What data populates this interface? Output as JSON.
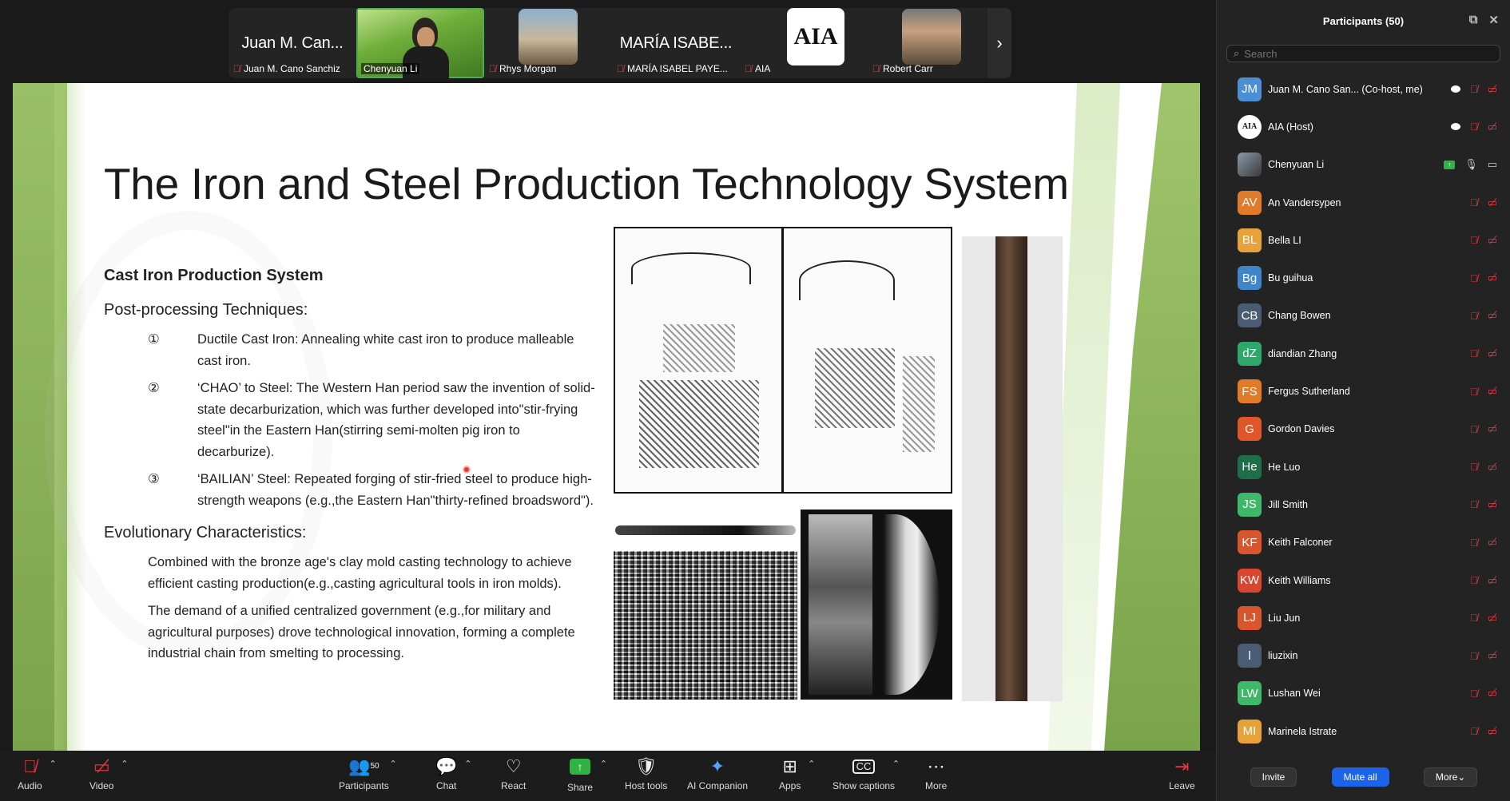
{
  "gallery": {
    "tiles": [
      {
        "big": "Juan M. Can...",
        "label": "Juan M. Cano Sanchiz",
        "muted": true
      },
      {
        "big": "",
        "label": "Chenyuan Li",
        "muted": false
      },
      {
        "big": "",
        "label": "Rhys Morgan",
        "muted": true
      },
      {
        "big": "MARÍA ISABE...",
        "label": "MARÍA ISABEL PAYE...",
        "muted": true
      },
      {
        "big": "",
        "label": "AIA",
        "muted": true,
        "logo": "AIA"
      },
      {
        "big": "",
        "label": "Robert Carr",
        "muted": true
      }
    ],
    "next_icon": "chevron-right-icon"
  },
  "slide": {
    "title": "The Iron and Steel Production Technology System",
    "section": "Cast Iron Production System",
    "subheading": "Post-processing Techniques:",
    "items": [
      {
        "num": "①",
        "text": "Ductile Cast Iron: Annealing white cast iron to produce malleable cast iron."
      },
      {
        "num": "②",
        "text": "‘CHAO’ to Steel: The Western Han period saw the invention of solid-state decarburization, which was further developed into\"stir-frying steel\"in the Eastern Han(stirring semi-molten pig iron to decarburize)."
      },
      {
        "num": "③",
        "text": "‘BAILIAN’ Steel: Repeated forging of stir-fried steel to produce high-strength weapons (e.g.,the Eastern Han\"thirty-refined broadsword\")."
      }
    ],
    "evo_heading": "Evolutionary Characteristics:",
    "paragraphs": [
      "Combined with the bronze age's clay mold casting technology to achieve efficient casting production(e.g.,casting agricultural tools in iron molds).",
      "The demand of a unified centralized government (e.g.,for military and agricultural purposes) drove technological innovation, forming a complete industrial chain from smelting to processing."
    ]
  },
  "panel": {
    "title": "Participants (50)",
    "search_placeholder": "Search",
    "participants": [
      {
        "initials": "JM",
        "name": "Juan M. Cano San...  (Co-host, me)",
        "color": "#4a8fd6",
        "cloud": true
      },
      {
        "initials": "AIA",
        "name": "AIA (Host)",
        "color": "#ffffff",
        "cloud": true,
        "logo": true
      },
      {
        "initials": "",
        "name": "Chenyuan Li",
        "color": "#6b7b8c",
        "active": true
      },
      {
        "initials": "AV",
        "name": "An Vandersypen",
        "color": "#e07b2a"
      },
      {
        "initials": "BL",
        "name": "Bella LI",
        "color": "#e8a23a"
      },
      {
        "initials": "Bg",
        "name": "Bu guihua",
        "color": "#3f86c9"
      },
      {
        "initials": "CB",
        "name": "Chang Bowen",
        "color": "#4a5c73"
      },
      {
        "initials": "dZ",
        "name": "diandian Zhang",
        "color": "#2ea86a"
      },
      {
        "initials": "FS",
        "name": "Fergus Sutherland",
        "color": "#e07b2a"
      },
      {
        "initials": "G",
        "name": "Gordon Davies",
        "color": "#e0552a"
      },
      {
        "initials": "He",
        "name": "He Luo",
        "color": "#1e6e4a"
      },
      {
        "initials": "JS",
        "name": "Jill Smith",
        "color": "#3fb86a"
      },
      {
        "initials": "KF",
        "name": "Keith Falconer",
        "color": "#d9552e"
      },
      {
        "initials": "KW",
        "name": "Keith Williams",
        "color": "#d9452e"
      },
      {
        "initials": "LJ",
        "name": "Liu Jun",
        "color": "#d9552e"
      },
      {
        "initials": "l",
        "name": "liuzixin",
        "color": "#4a5c73"
      },
      {
        "initials": "LW",
        "name": "Lushan Wei",
        "color": "#3fb86a"
      },
      {
        "initials": "MI",
        "name": "Marinela Istrate",
        "color": "#e8a23a"
      }
    ],
    "footer": {
      "invite": "Invite",
      "mute_all": "Mute all",
      "more": "More"
    }
  },
  "toolbar": {
    "audio": "Audio",
    "video": "Video",
    "participants": "Participants",
    "participants_count": "50",
    "chat": "Chat",
    "react": "React",
    "share": "Share",
    "host_tools": "Host tools",
    "ai_companion": "AI Companion",
    "apps": "Apps",
    "show_captions": "Show captions",
    "more": "More",
    "leave": "Leave"
  }
}
